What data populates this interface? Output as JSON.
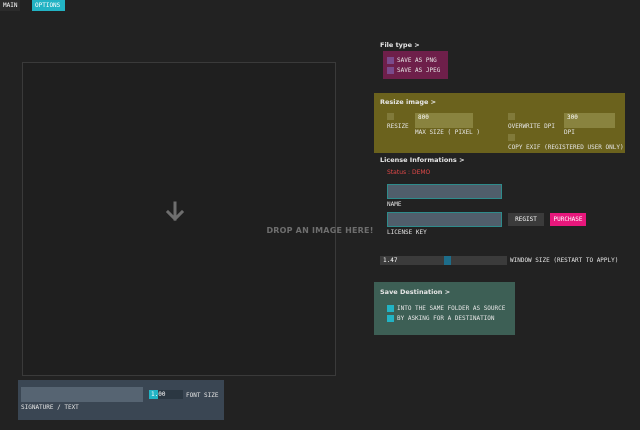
{
  "tabs": {
    "main": "MAIN",
    "options": "OPTIONS"
  },
  "dropzone": {
    "text": "DROP AN IMAGE HERE!"
  },
  "signature": {
    "value": "",
    "label": "SIGNATURE / TEXT",
    "font_size_value": "1.00",
    "font_size_label": "FONT SIZE"
  },
  "file_type": {
    "heading": "File type >",
    "options": [
      {
        "label": "SAVE AS PNG",
        "checked": false
      },
      {
        "label": "SAVE AS JPEG",
        "checked": false
      }
    ]
  },
  "resize": {
    "heading": "Resize image >",
    "resize_label": "RESIZE",
    "max_size_value": "800",
    "max_size_label": "MAX SIZE ( PIXEL )",
    "overwrite_dpi_label": "OVERWRITE DPI",
    "dpi_value": "300",
    "dpi_label": "DPI",
    "copy_exif_label": "COPY EXIF (REGISTERED USER ONLY)"
  },
  "license": {
    "heading": "License Informations >",
    "status": "Status : DEMO",
    "name_value": "",
    "name_label": "NAME",
    "key_value": "",
    "key_label": "LICENSE KEY",
    "regist_button": "REGIST",
    "purchase_button": "PURCHASE"
  },
  "window_size": {
    "value": "1.47",
    "label": "WINDOW SIZE (RESTART TO APPLY)",
    "level": 0.53
  },
  "save_destination": {
    "heading": "Save Destination >",
    "options": [
      {
        "label": "INTO THE SAME FOLDER AS SOURCE",
        "checked": true
      },
      {
        "label": "BY ASKING FOR A DESTINATION",
        "checked": true
      }
    ]
  },
  "colors": {
    "background": "#222222",
    "file_type_panel": "#6e1f4a",
    "resize_panel": "#6b621d",
    "save_destination_panel": "#3d5f55",
    "signature_panel": "#3a4653",
    "accent_cyan": "#22b3c4",
    "purchase_pink": "#e8177c",
    "status_red": "#e04848"
  }
}
